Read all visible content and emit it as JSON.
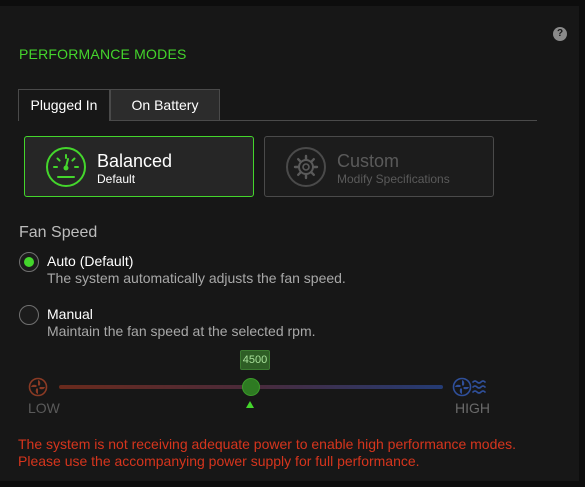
{
  "help": {
    "label": "?"
  },
  "header": {
    "title": "PERFORMANCE MODES"
  },
  "tabs": [
    {
      "label": "Plugged In",
      "active": true
    },
    {
      "label": "On Battery",
      "active": false
    }
  ],
  "modes": [
    {
      "name": "Balanced",
      "subtitle": "Default",
      "icon": "speedometer-icon",
      "selected": true
    },
    {
      "name": "Custom",
      "subtitle": "Modify Specifications",
      "icon": "gear-icon",
      "selected": false
    }
  ],
  "fan": {
    "title": "Fan Speed",
    "options": [
      {
        "label": "Auto (Default)",
        "description": "The system automatically adjusts the fan speed.",
        "checked": true
      },
      {
        "label": "Manual",
        "description": "Maintain the fan speed at the selected rpm.",
        "checked": false
      }
    ],
    "slider": {
      "value": "4500",
      "low_label": "LOW",
      "high_label": "HIGH",
      "low_icon": "fan-low-icon",
      "high_icon": "fan-high-icon"
    }
  },
  "warning": {
    "line1": "The system is not receiving adequate power to enable high performance modes.",
    "line2": "Please use the accompanying power supply for full performance."
  },
  "colors": {
    "accent": "#44d62c",
    "warning": "#d6351d",
    "background": "#171717"
  }
}
